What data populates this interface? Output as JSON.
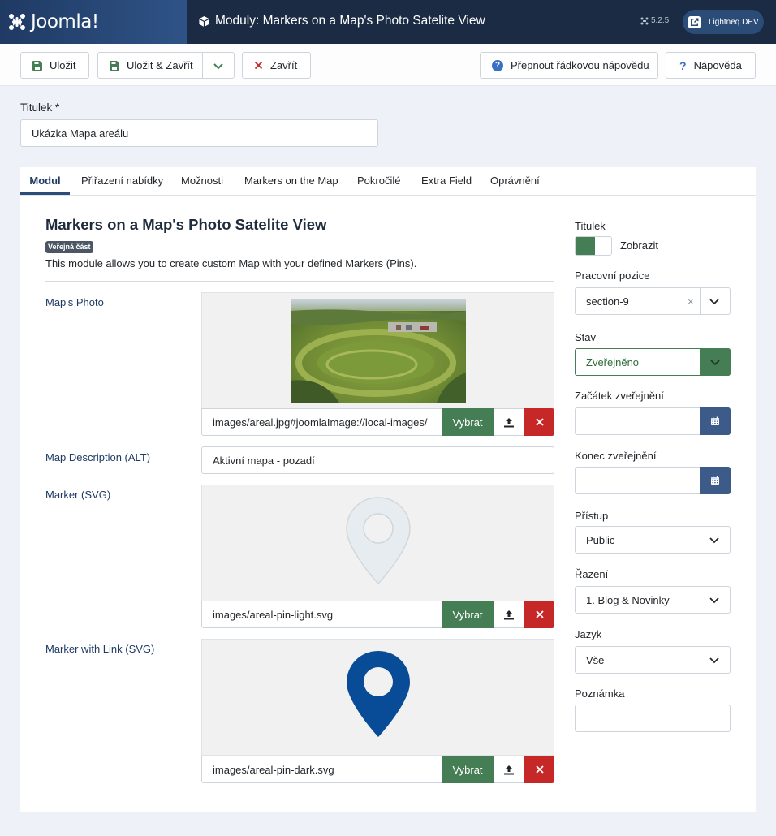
{
  "header": {
    "logo_text": "Joomla!",
    "title": "Moduly: Markers on a Map's Photo Satelite View",
    "version": "5.2.5",
    "user_button": "Lightneq DEV"
  },
  "toolbar": {
    "save_label": "Uložit",
    "save_close_label": "Uložit & Zavřít",
    "close_label": "Zavřít",
    "inline_help_label": "Přepnout řádkovou nápovědu",
    "help_label": "Nápověda"
  },
  "title_field": {
    "label": "Titulek *",
    "value": "Ukázka Mapa areálu"
  },
  "tabs": [
    "Modul",
    "Přiřazení nabídky",
    "Možnosti",
    "Markers on the Map",
    "Pokročilé",
    "Extra Field",
    "Oprávnění"
  ],
  "module": {
    "heading": "Markers on a Map's Photo Satelite View",
    "badge": "Veřejná část",
    "description": "This module allows you to create custom Map with your defined Markers (Pins)."
  },
  "fields": {
    "map_photo": {
      "label": "Map's Photo",
      "value": "images/areal.jpg#joomlaImage://local-images/"
    },
    "map_alt": {
      "label": "Map Description (ALT)",
      "value": "Aktivní mapa - pozadí"
    },
    "marker": {
      "label": "Marker (SVG)",
      "value": "images/areal-pin-light.svg"
    },
    "marker_link": {
      "label": "Marker with Link (SVG)",
      "value": "images/areal-pin-dark.svg"
    },
    "select_label": "Vybrat"
  },
  "sidebar": {
    "title_label": "Titulek",
    "title_switch": "Zobrazit",
    "position_label": "Pracovní pozice",
    "position_value": "section-9",
    "position_clear": "×",
    "state_label": "Stav",
    "state_value": "Zveřejněno",
    "publish_up_label": "Začátek zveřejnění",
    "publish_down_label": "Konec zveřejnění",
    "access_label": "Přístup",
    "access_value": "Public",
    "ordering_label": "Řazení",
    "ordering_value": "1. Blog & Novinky",
    "language_label": "Jazyk",
    "language_value": "Vše",
    "note_label": "Poznámka"
  },
  "colors": {
    "header_bg": "#1a2b43",
    "accent_green": "#457d54",
    "danger_red": "#c52827",
    "pin_light": "#e6ecef",
    "pin_dark": "#084c98"
  }
}
